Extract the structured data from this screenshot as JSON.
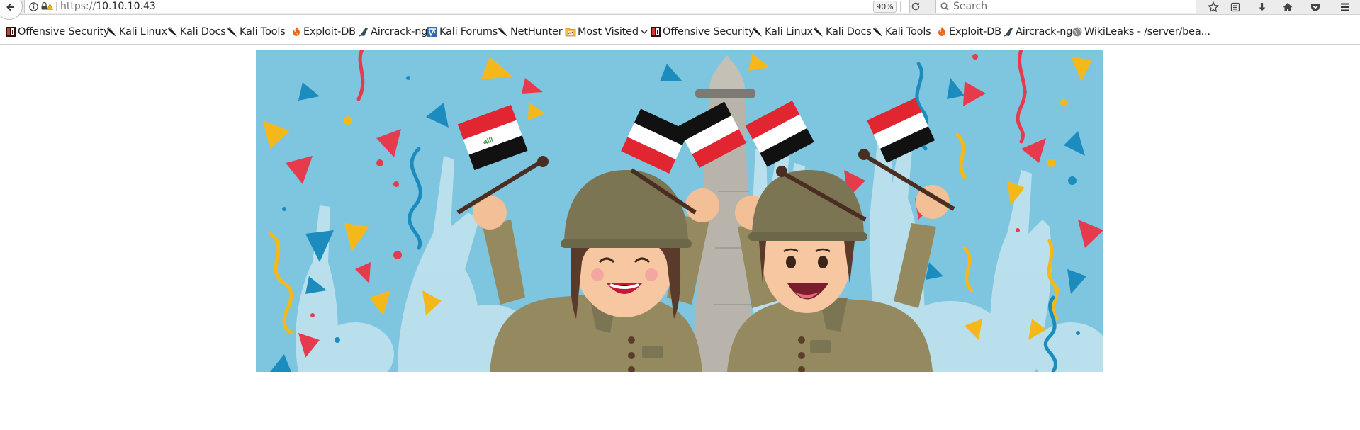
{
  "nav": {
    "url_scheme": "https://",
    "url_host": "10.10.10.43",
    "zoom": "90%",
    "search_placeholder": "Search"
  },
  "toolbar_icons": [
    "star-icon",
    "reading-list-icon",
    "download-icon",
    "home-icon",
    "pocket-icon",
    "menu-icon"
  ],
  "bookmarks": [
    {
      "label": "Offensive Security",
      "icon": "offsec-icon"
    },
    {
      "label": "Kali Linux",
      "icon": "kali-dragon-icon"
    },
    {
      "label": "Kali Docs",
      "icon": "kali-dragon-icon"
    },
    {
      "label": "Kali Tools",
      "icon": "kali-dragon-icon"
    },
    {
      "label": "Exploit-DB",
      "icon": "exploitdb-icon"
    },
    {
      "label": "Aircrack-ng",
      "icon": "aircrack-icon"
    },
    {
      "label": "Kali Forums",
      "icon": "kali-forums-icon"
    },
    {
      "label": "NetHunter",
      "icon": "kali-dragon-icon"
    },
    {
      "label": "Most Visited",
      "icon": "most-visited-folder-icon"
    },
    {
      "label": "Offensive Security",
      "icon": "offsec-icon"
    },
    {
      "label": "Kali Linux",
      "icon": "kali-dragon-icon"
    },
    {
      "label": "Kali Docs",
      "icon": "kali-dragon-icon"
    },
    {
      "label": "Kali Tools",
      "icon": "kali-dragon-icon"
    },
    {
      "label": "Exploit-DB",
      "icon": "exploitdb-icon"
    },
    {
      "label": "Aircrack-ng",
      "icon": "aircrack-icon"
    },
    {
      "label": "WikiLeaks - /server/bea...",
      "icon": "globe-icon"
    }
  ],
  "colors": {
    "sky": "#7ec6df",
    "soldier_uniform": "#958960",
    "helmet": "#7c7554",
    "flag_red": "#e12631",
    "flag_black": "#111111",
    "flag_green": "#2f8a3c"
  }
}
